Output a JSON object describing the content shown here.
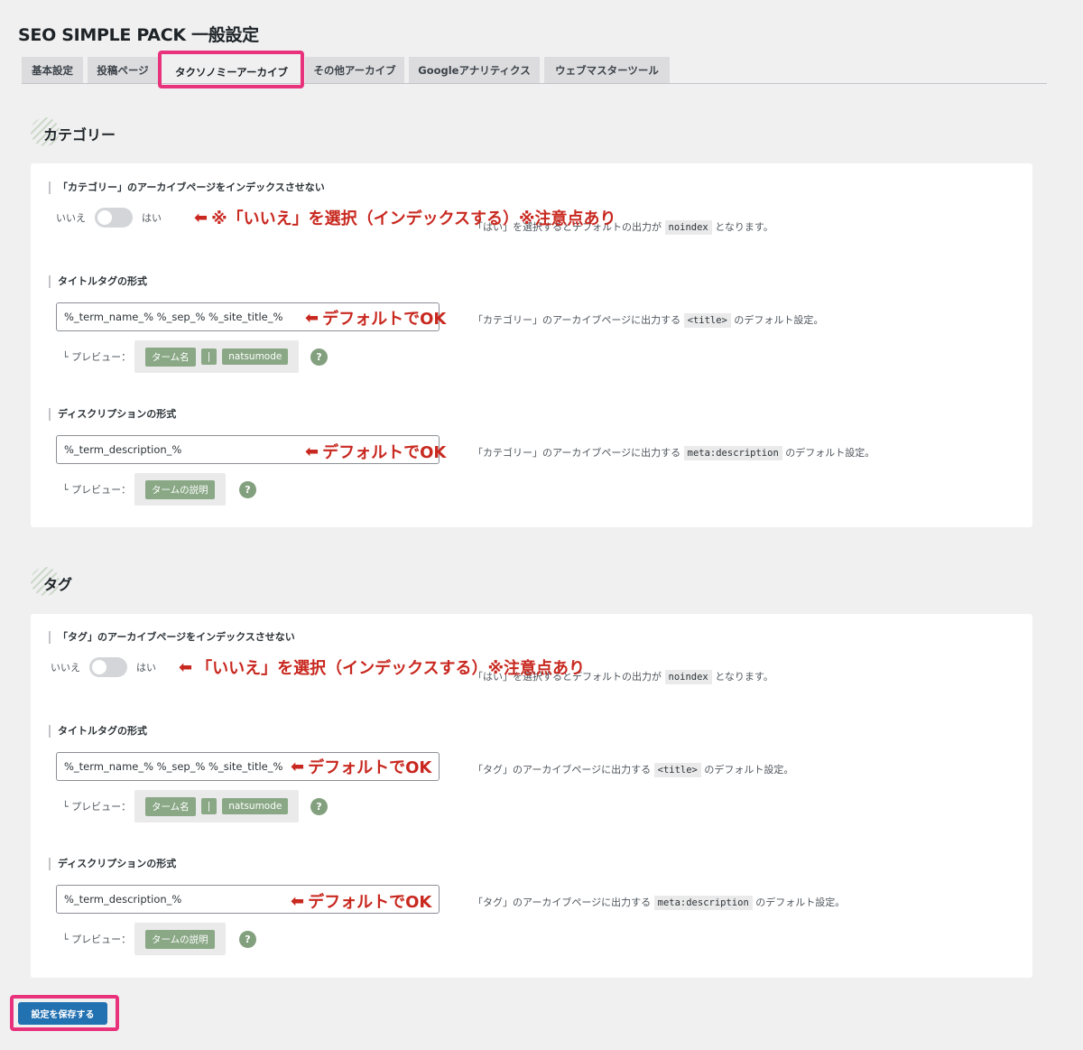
{
  "page_title": "SEO SIMPLE PACK 一般設定",
  "tabs": [
    {
      "label": "基本設定"
    },
    {
      "label": "投稿ページ"
    },
    {
      "label": "タクソノミーアーカイブ"
    },
    {
      "label": "その他アーカイブ"
    },
    {
      "label": "Googleアナリティクス"
    },
    {
      "label": "ウェブマスターツール"
    }
  ],
  "active_tab": "タクソノミーアーカイブ",
  "accent_color": "#e8327c",
  "annotation_color": "#c8281f",
  "category": {
    "heading": "カテゴリー",
    "noindex_label": "「カテゴリー」のアーカイブページをインデックスさせない",
    "toggle_off": "いいえ",
    "toggle_on": "はい",
    "noindex_desc_pre": "「はい」を選択するとデフォルトの出力が",
    "noindex_code": "noindex",
    "noindex_desc_post": "となります。",
    "title_label": "タイトルタグの形式",
    "title_value": "%_term_name_% %_sep_% %_site_title_%",
    "title_desc_pre": "「カテゴリー」のアーカイブページに出力する",
    "title_code": "<title>",
    "title_desc_post": "のデフォルト設定。",
    "preview_label": "└ プレビュー：",
    "title_preview": [
      "ターム名",
      "|",
      "natsumode"
    ],
    "desc_label": "ディスクリプションの形式",
    "desc_value": "%_term_description_%",
    "desc_desc_pre": "「カテゴリー」のアーカイブページに出力する",
    "desc_code": "meta:description",
    "desc_desc_post": "のデフォルト設定。",
    "desc_preview": [
      "タームの説明"
    ],
    "help": "?"
  },
  "tag": {
    "heading": "タグ",
    "noindex_label": "「タグ」のアーカイブページをインデックスさせない",
    "toggle_off": "いいえ",
    "toggle_on": "はい",
    "noindex_desc_pre": "「はい」を選択するとデフォルトの出力が",
    "noindex_code": "noindex",
    "noindex_desc_post": "となります。",
    "title_label": "タイトルタグの形式",
    "title_value": "%_term_name_% %_sep_% %_site_title_%",
    "title_desc_pre": "「タグ」のアーカイブページに出力する",
    "title_code": "<title>",
    "title_desc_post": "のデフォルト設定。",
    "preview_label": "└ プレビュー：",
    "title_preview": [
      "ターム名",
      "|",
      "natsumode"
    ],
    "desc_label": "ディスクリプションの形式",
    "desc_value": "%_term_description_%",
    "desc_desc_pre": "「タグ」のアーカイブページに出力する",
    "desc_code": "meta:description",
    "desc_desc_post": "のデフォルト設定。",
    "desc_preview": [
      "タームの説明"
    ],
    "help": "?"
  },
  "annotations": {
    "arrow": "⬅",
    "cat_noindex": "※「いいえ」を選択（インデックスする）※注意点あり",
    "tag_noindex": "「いいえ」を選択（インデックスする）※注意点あり",
    "default_ok": "デフォルトでOK"
  },
  "save_button": "設定を保存する"
}
